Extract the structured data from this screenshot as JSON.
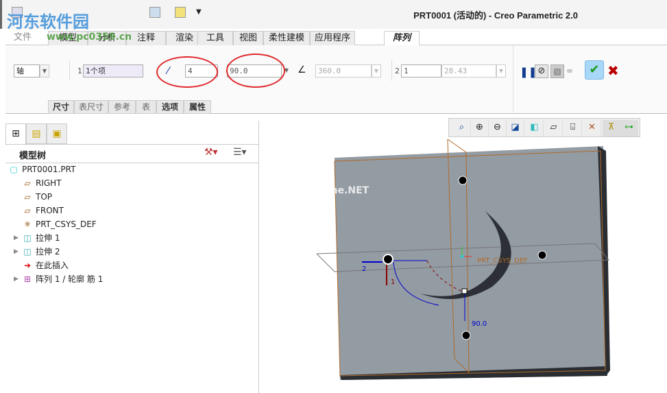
{
  "window": {
    "title": "PRT0001 (活动的) - Creo Parametric 2.0"
  },
  "watermark": {
    "name": "河东软件园",
    "url": "www.pc0359.cn",
    "net": "me.NET"
  },
  "tabs": [
    {
      "label": "文件"
    },
    {
      "label": "模型"
    },
    {
      "label": "分析"
    },
    {
      "label": "注释"
    },
    {
      "label": "渲染"
    },
    {
      "label": "工具"
    },
    {
      "label": "视图"
    },
    {
      "label": "柔性建模"
    },
    {
      "label": "应用程序"
    },
    {
      "label": "阵列",
      "active": true
    }
  ],
  "ribbon": {
    "pattern_type": "轴",
    "dir1_index": "1",
    "dir1_ref": "1个项",
    "members": "4",
    "angle": "90.0",
    "total_angle": "360.0",
    "dir2_index": "2",
    "dir2_members": "1",
    "dir2_spacing": "28.43",
    "icons": [
      "pause-icon",
      "no-preview-icon",
      "preview-geometry-icon",
      "glasses-icon",
      "confirm-check-icon",
      "cancel-x-icon"
    ]
  },
  "subtabs": [
    {
      "label": "尺寸",
      "bold": true
    },
    {
      "label": "表尺寸"
    },
    {
      "label": "参考"
    },
    {
      "label": "表"
    },
    {
      "label": "选项",
      "bold": true
    },
    {
      "label": "属性",
      "bold": true
    }
  ],
  "panel": {
    "header": "模型树"
  },
  "tree": [
    {
      "label": "PRT0001.PRT",
      "icon": "part-icon"
    },
    {
      "label": "RIGHT",
      "icon": "datum-plane-icon"
    },
    {
      "label": "TOP",
      "icon": "datum-plane-icon"
    },
    {
      "label": "FRONT",
      "icon": "datum-plane-icon"
    },
    {
      "label": "PRT_CSYS_DEF",
      "icon": "csys-icon"
    },
    {
      "label": "拉伸 1",
      "icon": "extrude-icon",
      "expandable": true
    },
    {
      "label": "拉伸 2",
      "icon": "extrude-icon",
      "expandable": true
    },
    {
      "label": "在此插入",
      "icon": "insert-here-arrow-icon"
    },
    {
      "label": "阵列 1 / 轮廓 筋 1",
      "icon": "pattern-icon",
      "expandable": true
    }
  ],
  "viewport": {
    "csys_label": "PRT_CSYS_DEF",
    "angle_dim": "90.0",
    "dir1": "1",
    "dir2": "2"
  },
  "colors": {
    "accent_circle": "#e0282c",
    "model": "#939ba3",
    "datum": "#b06a2a"
  }
}
